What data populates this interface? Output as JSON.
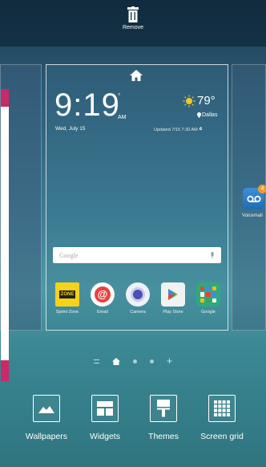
{
  "top": {
    "remove_label": "Remove"
  },
  "clock": {
    "time": "9:19",
    "ampm": "AM",
    "date": "Wed, July 15"
  },
  "weather": {
    "temp": "79°",
    "location": "Dallas",
    "updated": "Updated 7/15 7:30 AM"
  },
  "search": {
    "placeholder": "Google"
  },
  "apps": [
    {
      "label": "Sprint Zone",
      "icon": "sprint-zone-icon"
    },
    {
      "label": "Email",
      "icon": "email-icon"
    },
    {
      "label": "Camera",
      "icon": "camera-icon"
    },
    {
      "label": "Play Store",
      "icon": "play-store-icon"
    },
    {
      "label": "Google",
      "icon": "google-folder-icon"
    }
  ],
  "right_panel": {
    "voicemail_label": "Voicemail",
    "badge": "4"
  },
  "bottom": [
    {
      "label": "Wallpapers",
      "icon": "wallpapers-icon"
    },
    {
      "label": "Widgets",
      "icon": "widgets-icon"
    },
    {
      "label": "Themes",
      "icon": "themes-icon"
    },
    {
      "label": "Screen grid",
      "icon": "screen-grid-icon"
    }
  ]
}
